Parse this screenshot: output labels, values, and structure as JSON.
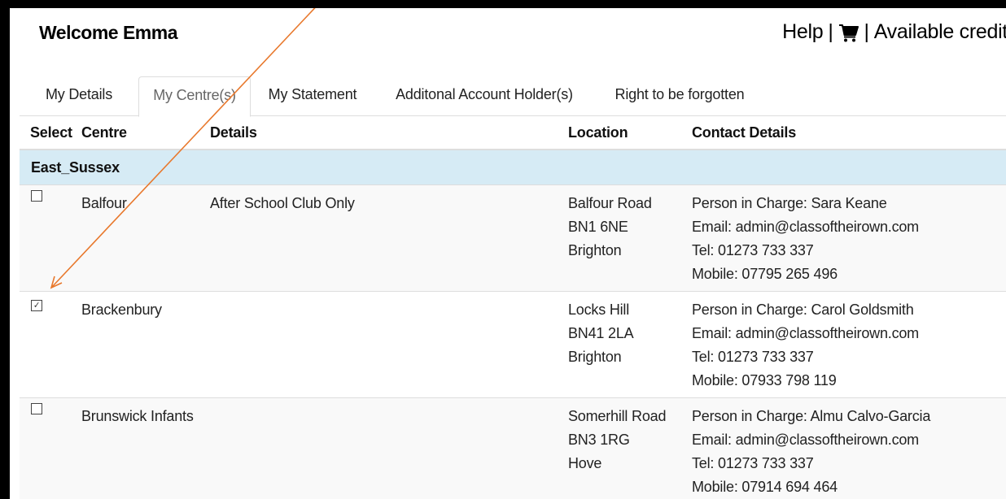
{
  "header": {
    "welcome": "Welcome Emma",
    "help_label": "Help",
    "separator": "|",
    "cart_icon": "cart-icon",
    "credit_label": "Available credit"
  },
  "tabs": [
    {
      "label": "My Details",
      "active": false
    },
    {
      "label": "My Centre(s)",
      "active": true
    },
    {
      "label": "My Statement",
      "active": false
    },
    {
      "label": "Additonal Account Holder(s)",
      "active": false
    },
    {
      "label": "Right to be forgotten",
      "active": false
    }
  ],
  "table": {
    "columns": [
      "Select",
      "Centre",
      "Details",
      "Location",
      "Contact Details"
    ],
    "group": "East_Sussex",
    "rows": [
      {
        "checked": false,
        "centre": "Balfour",
        "details": "After School Club Only",
        "location": [
          "Balfour Road",
          "BN1 6NE",
          "Brighton"
        ],
        "contact": [
          "Person in Charge: Sara Keane",
          "Email: admin@classoftheirown.com",
          "Tel: 01273 733 337",
          "Mobile: 07795 265 496"
        ]
      },
      {
        "checked": true,
        "centre": "Brackenbury",
        "details": "",
        "location": [
          "Locks Hill",
          "BN41 2LA",
          "Brighton"
        ],
        "contact": [
          "Person in Charge: Carol Goldsmith",
          "Email: admin@classoftheirown.com",
          "Tel: 01273 733 337",
          "Mobile: 07933 798 119"
        ]
      },
      {
        "checked": false,
        "centre": "Brunswick Infants",
        "details": "",
        "location": [
          "Somerhill Road",
          "BN3 1RG",
          "Hove"
        ],
        "contact": [
          "Person in Charge: Almu Calvo-Garcia",
          "Email: admin@classoftheirown.com",
          "Tel: 01273 733 337",
          "Mobile: 07914 694 464"
        ]
      }
    ]
  },
  "colors": {
    "group_background": "#d6ebf5",
    "annotation_arrow": "#e8782c",
    "frame": "#000000"
  }
}
